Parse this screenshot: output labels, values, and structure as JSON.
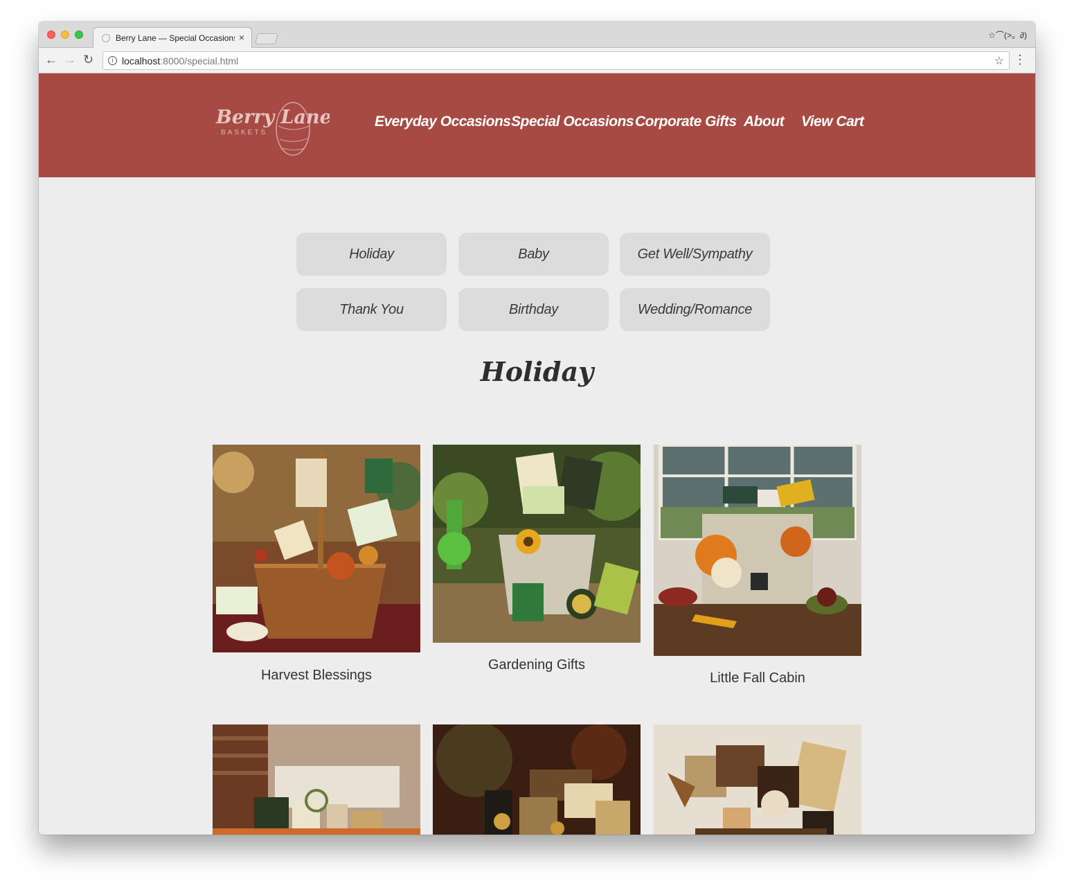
{
  "browser": {
    "tab_title": "Berry Lane — Special Occasions",
    "tab_close": "×",
    "profile_text": "☆⌒(>。∂)",
    "url_host": "localhost",
    "url_rest": ":8000/special.html"
  },
  "site": {
    "logo_brand": "Berry Lane",
    "logo_sub": "BASKETS",
    "nav": [
      "Everyday Occasions",
      "Special Occasions",
      "Corporate Gifts",
      "About",
      "View Cart"
    ],
    "accent_color": "#a64a43"
  },
  "categories": [
    "Holiday",
    "Baby",
    "Get Well/Sympathy",
    "Thank You",
    "Birthday",
    "Wedding/Romance"
  ],
  "section_title": "Holiday",
  "products": [
    {
      "name": "Harvest Blessings"
    },
    {
      "name": "Gardening Gifts"
    },
    {
      "name": "Little Fall Cabin"
    },
    {
      "name": ""
    },
    {
      "name": ""
    },
    {
      "name": ""
    }
  ]
}
